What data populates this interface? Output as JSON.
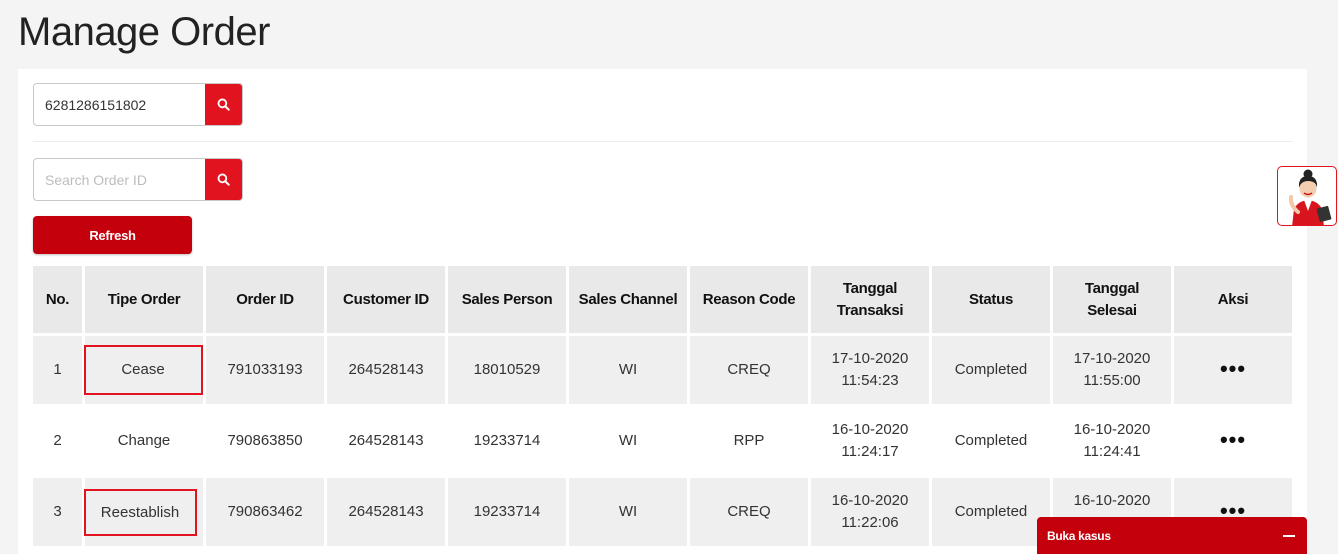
{
  "page": {
    "title": "Manage Order"
  },
  "msisdn_search": {
    "value": "6281286151802"
  },
  "order_search": {
    "placeholder": "Search Order ID"
  },
  "refresh_label": "Refresh",
  "table": {
    "headers": {
      "no": "No.",
      "tipe_order": "Tipe Order",
      "order_id": "Order ID",
      "customer_id": "Customer ID",
      "sales_person": "Sales Person",
      "sales_channel": "Sales Channel",
      "reason_code": "Reason Code",
      "tanggal_transaksi_1": "Tanggal",
      "tanggal_transaksi_2": "Transaksi",
      "status": "Status",
      "tanggal_selesai_1": "Tanggal",
      "tanggal_selesai_2": "Selesai",
      "aksi": "Aksi"
    },
    "rows": [
      {
        "no": "1",
        "tipe_order": "Cease",
        "order_id": "791033193",
        "customer_id": "264528143",
        "sales_person": "18010529",
        "sales_channel": "WI",
        "reason_code": "CREQ",
        "tgl_trans_date": "17-10-2020",
        "tgl_trans_time": "11:54:23",
        "status": "Completed",
        "tgl_selesai_date": "17-10-2020",
        "tgl_selesai_time": "11:55:00",
        "aksi": "•••"
      },
      {
        "no": "2",
        "tipe_order": "Change",
        "order_id": "790863850",
        "customer_id": "264528143",
        "sales_person": "19233714",
        "sales_channel": "WI",
        "reason_code": "RPP",
        "tgl_trans_date": "16-10-2020",
        "tgl_trans_time": "11:24:17",
        "status": "Completed",
        "tgl_selesai_date": "16-10-2020",
        "tgl_selesai_time": "11:24:41",
        "aksi": "•••"
      },
      {
        "no": "3",
        "tipe_order": "Reestablish",
        "order_id": "790863462",
        "customer_id": "264528143",
        "sales_person": "19233714",
        "sales_channel": "WI",
        "reason_code": "CREQ",
        "tgl_trans_date": "16-10-2020",
        "tgl_trans_time": "11:22:06",
        "status": "Completed",
        "tgl_selesai_date": "16-10-2020",
        "tgl_selesai_time": "",
        "aksi": "•••"
      }
    ]
  },
  "buka_kasus": {
    "label": "Buka kasus"
  },
  "icons": {
    "search": "search-icon",
    "minimize": "minus-icon",
    "assistant": "assistant-avatar-icon"
  },
  "colors": {
    "accent": "#e0131e",
    "button": "#c4000c"
  }
}
